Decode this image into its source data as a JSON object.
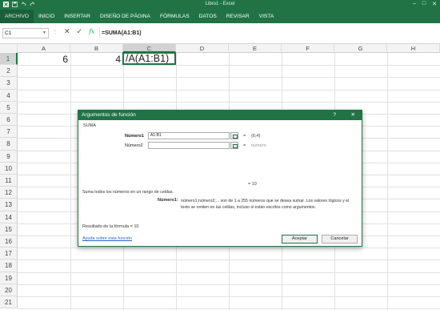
{
  "window": {
    "title": "Libro1 - Excel"
  },
  "ribbon": {
    "tabs": [
      "ARCHIVO",
      "INICIO",
      "INSERTAR",
      "DISEÑO DE PÁGINA",
      "FÓRMULAS",
      "DATOS",
      "REVISAR",
      "VISTA"
    ]
  },
  "formula_bar": {
    "name_box": "C1",
    "content": "=SUMA(A1:B1)"
  },
  "grid": {
    "columns": [
      "A",
      "B",
      "C",
      "D",
      "E",
      "F",
      "G",
      "H"
    ],
    "rows": [
      "1",
      "2",
      "3",
      "4",
      "5",
      "6",
      "7",
      "8",
      "9",
      "10",
      "11",
      "12",
      "13",
      "14",
      "15",
      "16",
      "17",
      "18",
      "19",
      "20",
      "21"
    ],
    "active_column": "C",
    "active_row": "1",
    "cells": {
      "A1": "6",
      "B1": "4",
      "C1": "/A(A1:B1)"
    }
  },
  "dialog": {
    "title": "Argumentos de función",
    "help_glyph": "?",
    "close_glyph": "✕",
    "function_name": "SUMA",
    "args": [
      {
        "label": "Número1",
        "value": "A1:B1",
        "eq": "=",
        "result": "{6;4}"
      },
      {
        "label": "Número2",
        "value": "",
        "eq": "=",
        "result": "número"
      }
    ],
    "result_line": "=  10",
    "description": "Suma todos los números en un rango de celdas.",
    "param_name": "Número1:",
    "param_description": "número1;número2;... son de 1 a 255 números que se desea sumar. Los valores lógicos y el texto se omiten en las celdas, incluso si están escritos como argumentos.",
    "formula_result": "Resultado de la fórmula =   10",
    "help_link": "Ayuda sobre esta función",
    "ok_label": "Aceptar",
    "cancel_label": "Cancelar"
  }
}
